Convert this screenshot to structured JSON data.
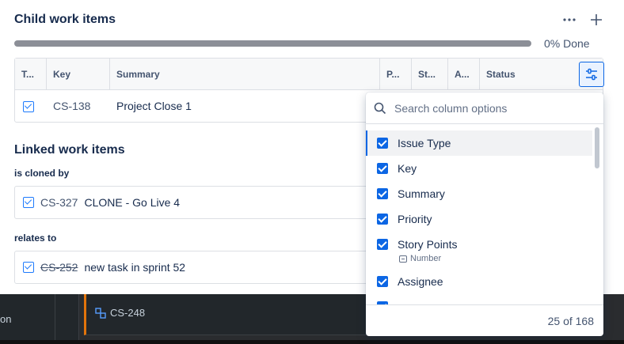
{
  "child": {
    "title": "Child work items",
    "more_icon": "more-horizontal-icon",
    "add_icon": "plus-icon",
    "progress_fraction": 0,
    "progress_label": "0% Done",
    "columns": [
      "T...",
      "Key",
      "Summary",
      "P...",
      "St...",
      "A...",
      "Status"
    ],
    "rows": [
      {
        "type_icon": "task-icon",
        "key": "CS-138",
        "summary": "Project Close 1"
      }
    ]
  },
  "linked": {
    "title": "Linked work items",
    "groups": [
      {
        "label": "is cloned by",
        "key": "CS-327",
        "summary": "CLONE - Go Live 4",
        "strikethrough": false
      },
      {
        "label": "relates to",
        "key": "CS-252",
        "summary": "new task in sprint 52",
        "strikethrough": true
      }
    ]
  },
  "column_popup": {
    "search_placeholder": "Search column options",
    "options": [
      {
        "label": "Issue Type",
        "checked": true
      },
      {
        "label": "Key",
        "checked": true
      },
      {
        "label": "Summary",
        "checked": true
      },
      {
        "label": "Priority",
        "checked": true
      },
      {
        "label": "Story Points",
        "checked": true,
        "subtype": "Number"
      },
      {
        "label": "Assignee",
        "checked": true
      }
    ],
    "count_label": "25 of 168"
  },
  "background": {
    "row_label": "on",
    "card_key": "CS-248"
  },
  "colors": {
    "accent": "#0c66e4",
    "text": "#172b4d",
    "progress": "#8c8f97",
    "card_edge": "#e2740b"
  }
}
